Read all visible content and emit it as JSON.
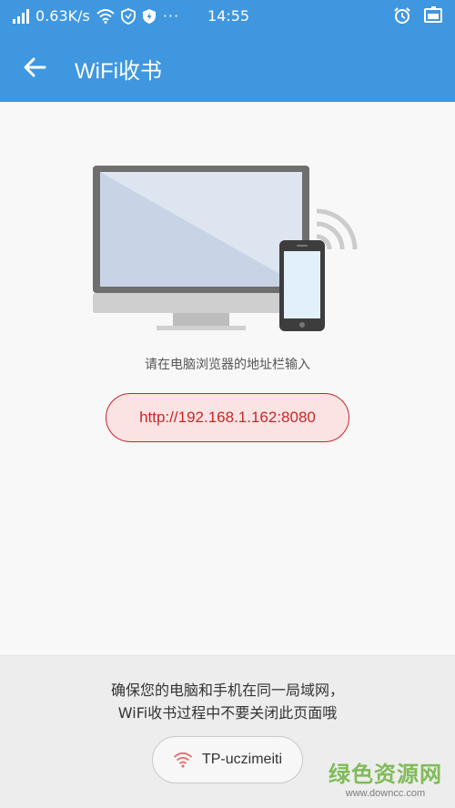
{
  "status_bar": {
    "network_speed": "0.63K/s",
    "time": "14:55",
    "icons": [
      "signal-icon",
      "wifi-icon",
      "shield-icon",
      "security-icon",
      "more-icon",
      "alarm-icon",
      "battery-icon"
    ],
    "more": "···"
  },
  "app_bar": {
    "title": "WiFi收书",
    "back_icon": "back-arrow-icon"
  },
  "main": {
    "hint": "请在电脑浏览器的地址栏输入",
    "url": "http://192.168.1.162:8080"
  },
  "footer": {
    "line1": "确保您的电脑和手机在同一局域网，",
    "line2": "WiFi收书过程中不要关闭此页面哦",
    "network_name": "TP-uczimeiti",
    "wifi_icon_color": "#e57373"
  },
  "watermark": {
    "main": "绿色资源网",
    "sub": "www.downcc.com"
  },
  "colors": {
    "primary": "#3f97e0",
    "url_border": "#c9242b",
    "url_text": "#c62828"
  }
}
